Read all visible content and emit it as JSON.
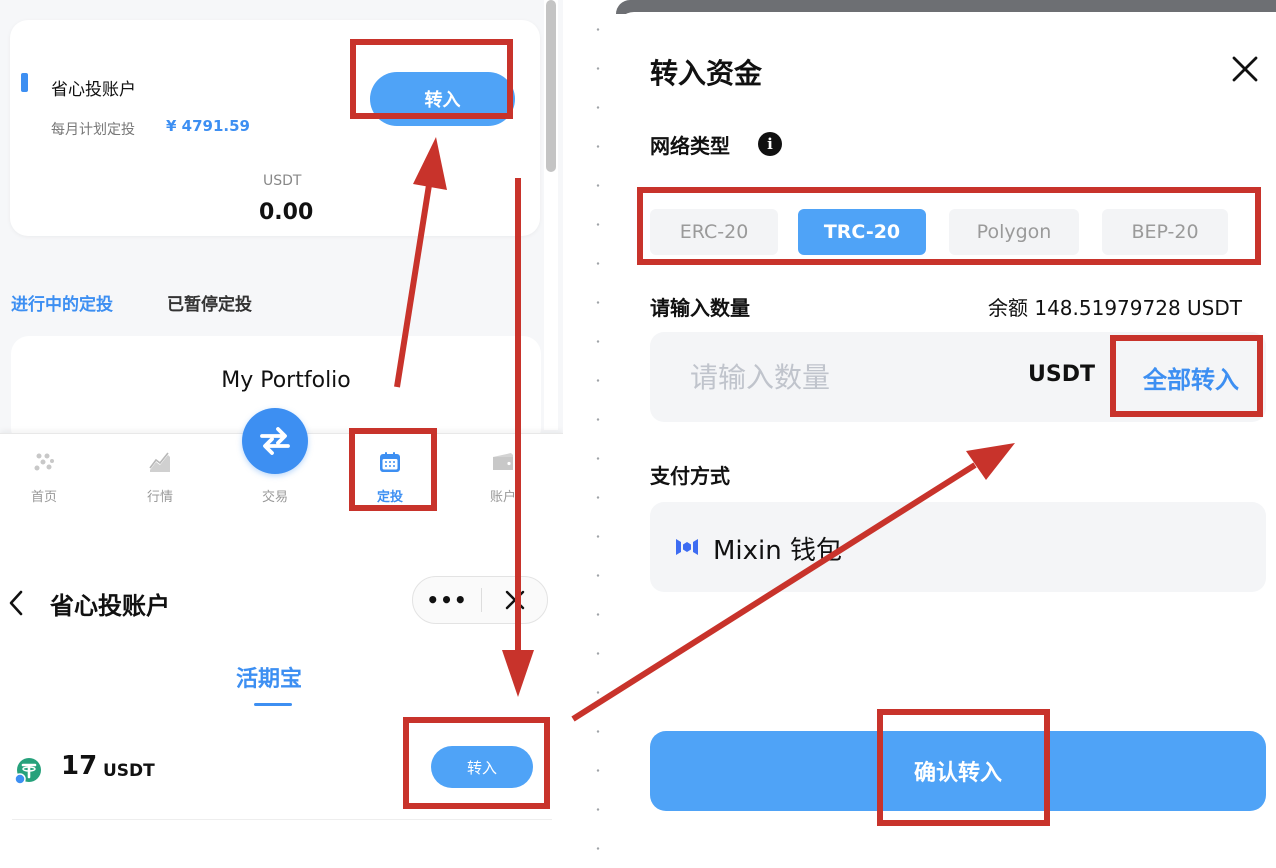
{
  "left_top": {
    "account_name": "省心投账户",
    "monthly_plan_label": "每月计划定投",
    "monthly_plan_value": "¥ 4791.59",
    "transfer_button": "转入",
    "currency": "USDT",
    "balance": "0.00",
    "tabs": [
      "进行中的定投",
      "已暂停定投"
    ],
    "portfolio_title": "My Portfolio",
    "nav": [
      {
        "label": "首页",
        "icon": "home-icon"
      },
      {
        "label": "行情",
        "icon": "market-chart-icon"
      },
      {
        "label": "交易",
        "icon": "swap-icon"
      },
      {
        "label": "定投",
        "icon": "calendar-icon"
      },
      {
        "label": "账户",
        "icon": "wallet-icon"
      }
    ]
  },
  "left_bottom": {
    "title": "省心投账户",
    "more_label": "•••",
    "subtab": "活期宝",
    "amount": "17",
    "unit": "USDT",
    "transfer_button": "转入"
  },
  "right_panel": {
    "title": "转入资金",
    "network_label": "网络类型",
    "info_label": "i",
    "networks": [
      {
        "label": "ERC-20",
        "active": false
      },
      {
        "label": "TRC-20",
        "active": true
      },
      {
        "label": "Polygon",
        "active": false
      },
      {
        "label": "BEP-20",
        "active": false
      }
    ],
    "amount_label": "请输入数量",
    "balance_text": "余额 148.51979728 USDT",
    "amount_placeholder": "请输入数量",
    "amount_unit": "USDT",
    "all_in_button": "全部转入",
    "payment_label": "支付方式",
    "wallet_name": "Mixin 钱包",
    "confirm_button": "确认转入"
  },
  "colors": {
    "accent": "#3d8ff2",
    "button": "#4fa3f7",
    "highlight": "#c8332b"
  }
}
